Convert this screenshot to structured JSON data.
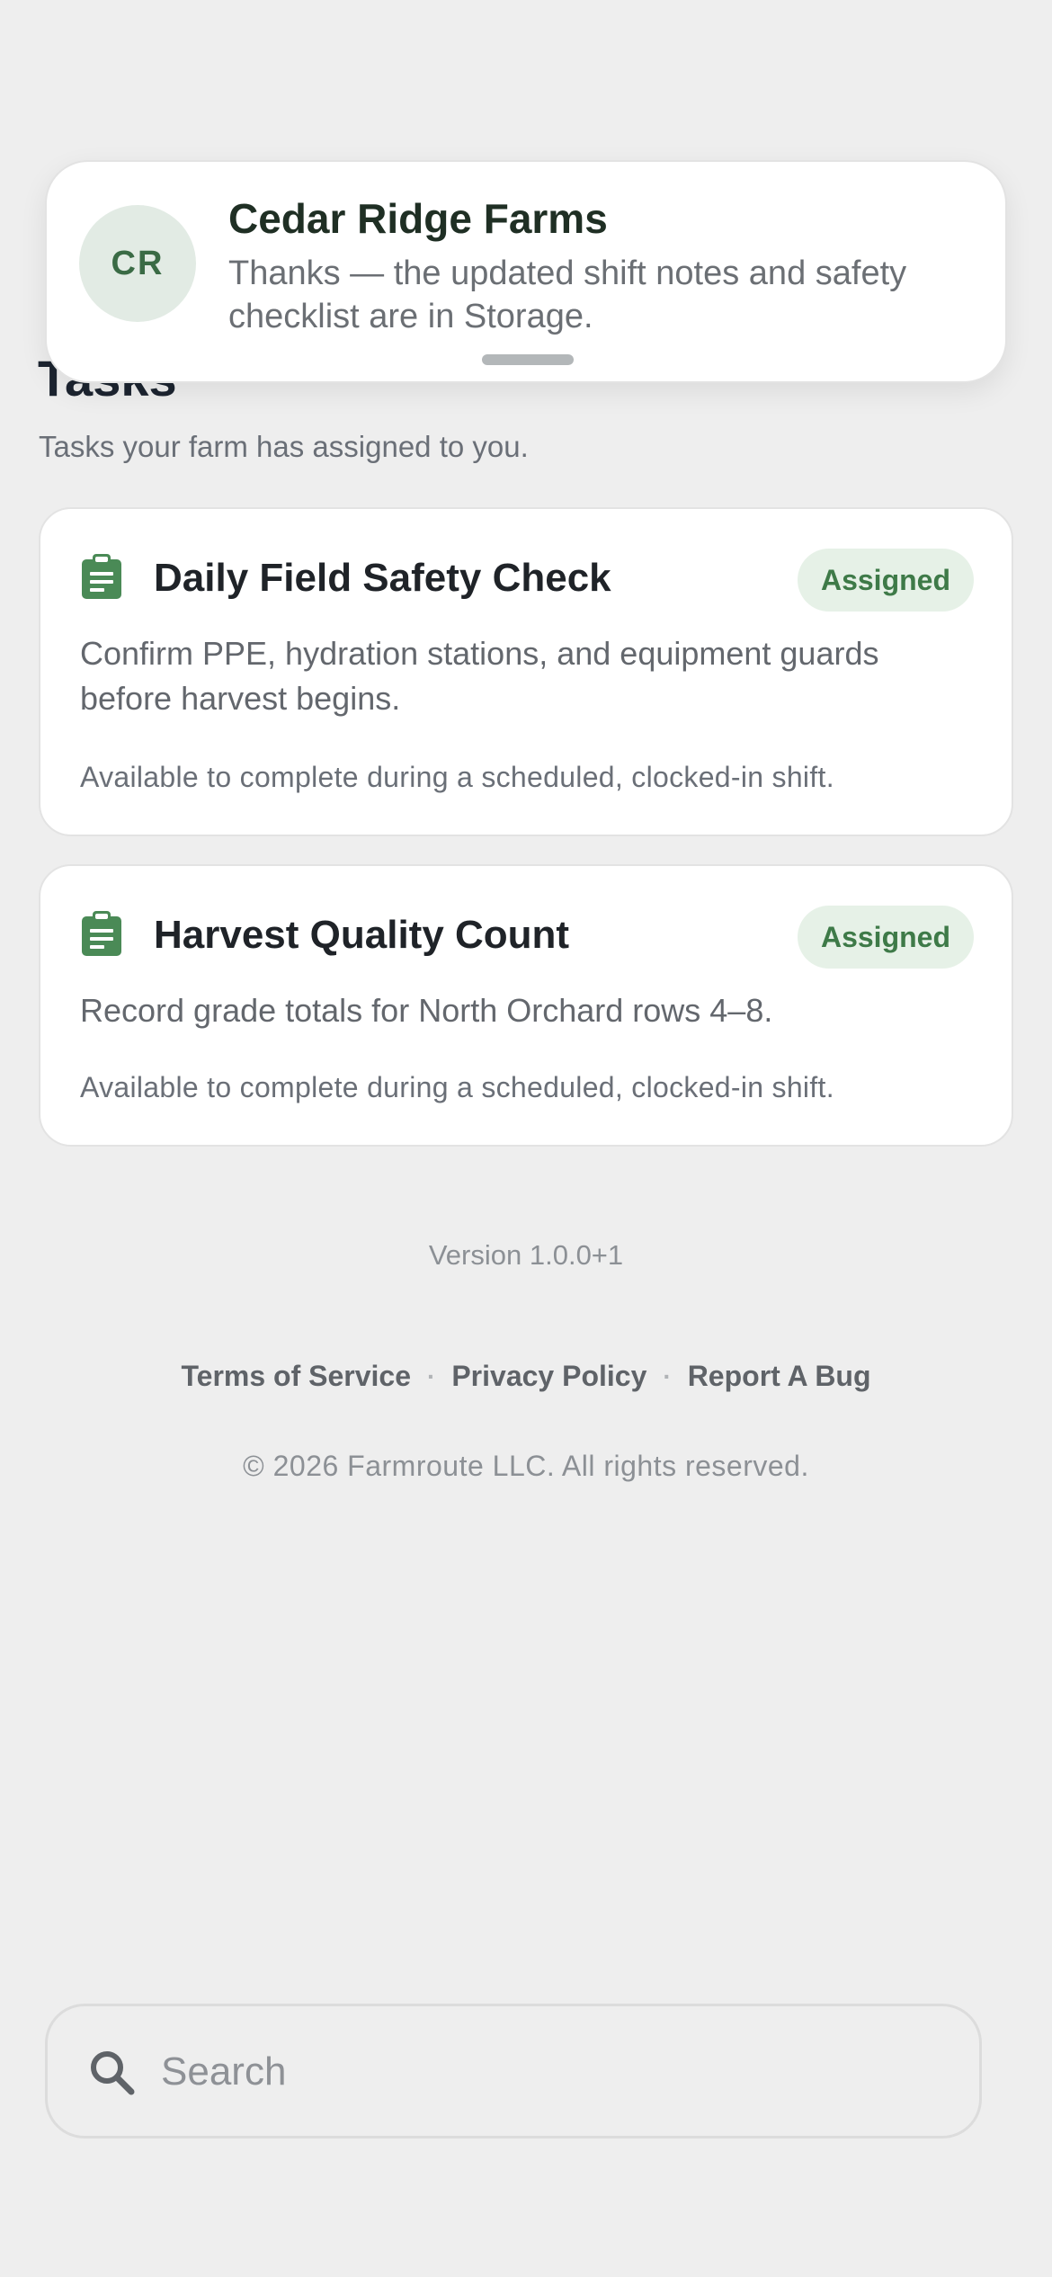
{
  "notification": {
    "avatar_initials": "CR",
    "title": "Cedar Ridge Farms",
    "message": "Thanks — the updated shift notes and safety checklist are in Storage."
  },
  "page": {
    "title": "Tasks",
    "subtitle": "Tasks your farm has assigned to you."
  },
  "tasks": [
    {
      "icon": "clipboard-icon",
      "title": "Daily Field Safety Check",
      "status": "Assigned",
      "description": "Confirm PPE, hydration stations, and equipment guards before harvest begins.",
      "note": "Available to complete during a scheduled, clocked-in shift."
    },
    {
      "icon": "clipboard-icon",
      "title": "Harvest Quality Count",
      "status": "Assigned",
      "description": "Record grade totals for North Orchard rows 4–8.",
      "note": "Available to complete during a scheduled, clocked-in shift."
    }
  ],
  "footer": {
    "version": "Version 1.0.0+1",
    "links": [
      "Terms of Service",
      "Privacy Policy",
      "Report A Bug"
    ],
    "separator": "·",
    "copyright": "© 2026 Farmroute LLC. All rights reserved."
  },
  "search": {
    "placeholder": "Search",
    "value": "",
    "icon": "search-icon"
  },
  "colors": {
    "accent_green": "#3e7a48",
    "badge_bg": "#e6f1e7",
    "background": "#eeeeee"
  }
}
